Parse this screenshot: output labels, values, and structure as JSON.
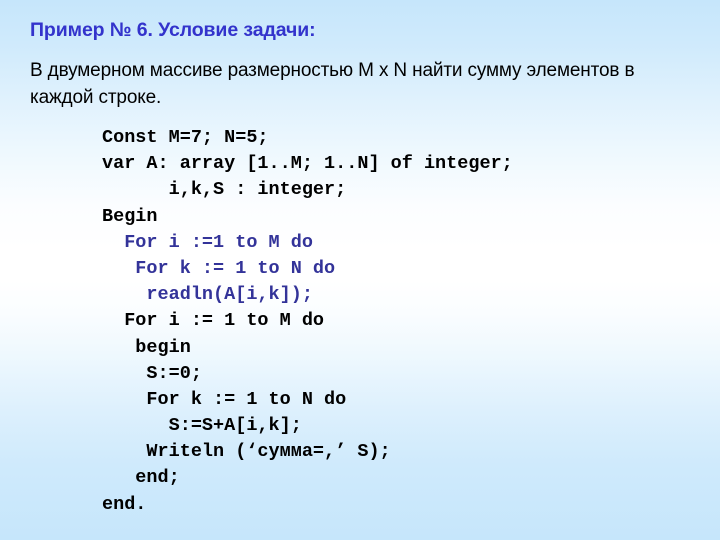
{
  "slide": {
    "title": "Пример № 6. Условие задачи:",
    "body": "В двумерном массиве размерностью M x N найти сумму элементов в каждой строке.",
    "title_color": "#3333cc",
    "body_color": "#000000",
    "background_edge_color": "#c6e6fb",
    "background_center_color": "#ffffff"
  },
  "code": {
    "language": "Pascal",
    "black_color": "#000000",
    "highlight_color": "#333399",
    "lines": [
      {
        "text": "Const M=7; N=5;",
        "color": "black"
      },
      {
        "text": "var A: array [1..M; 1..N] of integer;",
        "color": "black"
      },
      {
        "text": "      i,k,S : integer;",
        "color": "black"
      },
      {
        "text": "Begin",
        "color": "black"
      },
      {
        "text": "  For i :=1 to M do",
        "color": "navy"
      },
      {
        "text": "   For k := 1 to N do",
        "color": "navy"
      },
      {
        "text": "    readln(A[i,k]);",
        "color": "navy"
      },
      {
        "text": "  For i := 1 to M do",
        "color": "black"
      },
      {
        "text": "   begin",
        "color": "black"
      },
      {
        "text": "    S:=0;",
        "color": "black"
      },
      {
        "text": "    For k := 1 to N do",
        "color": "black"
      },
      {
        "text": "      S:=S+A[i,k];",
        "color": "black"
      },
      {
        "text": "    Writeln (‘сумма=,’ S);",
        "color": "black"
      },
      {
        "text": "   end;",
        "color": "black"
      },
      {
        "text": "end.",
        "color": "black"
      }
    ]
  }
}
